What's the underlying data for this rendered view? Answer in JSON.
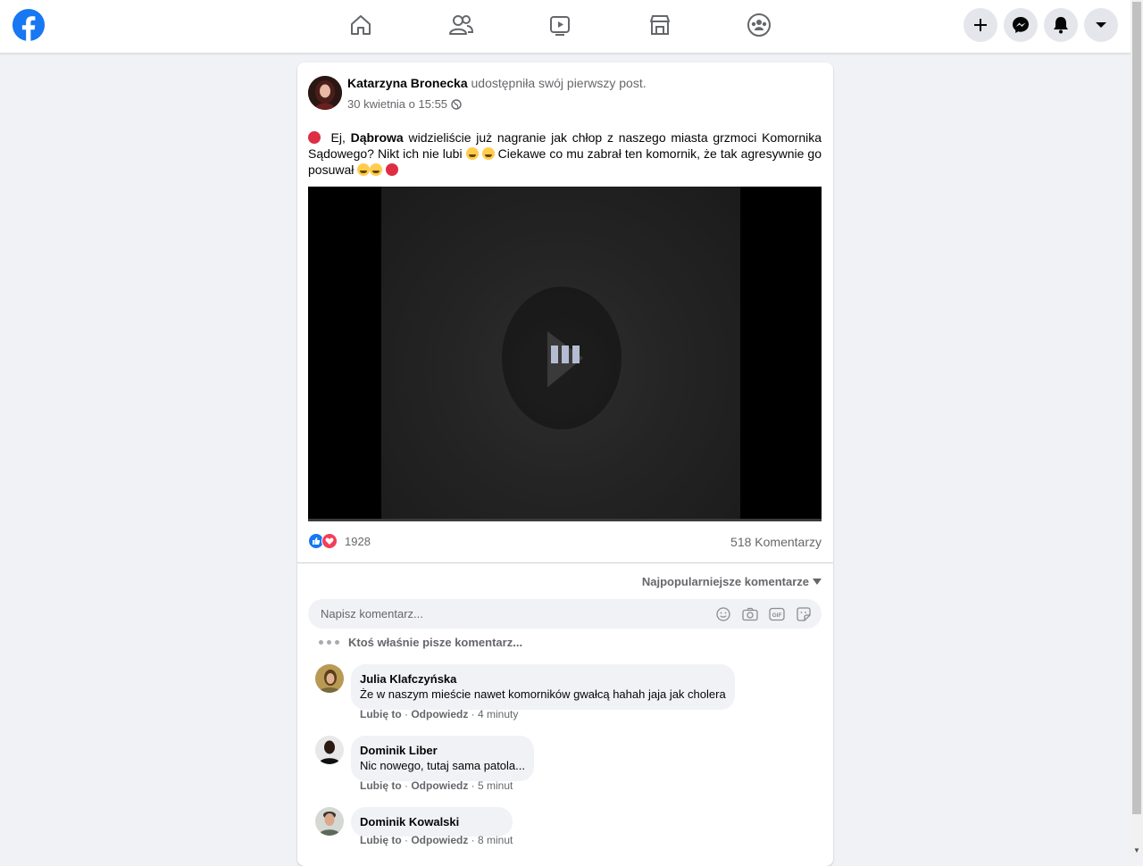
{
  "colors": {
    "brand": "#1877f2",
    "background": "#f0f2f5",
    "like": "#1877f2",
    "love": "#f33e58"
  },
  "topbar": {
    "nav": [
      "home-icon",
      "friends-icon",
      "watch-icon",
      "marketplace-icon",
      "groups-icon"
    ],
    "right_buttons": [
      "plus-icon",
      "messenger-icon",
      "notifications-icon",
      "chevron-down-icon"
    ]
  },
  "post": {
    "author": "Katarzyna Bronecka",
    "action": "udostępniła swój pierwszy post.",
    "time": "30 kwietnia o 15:55",
    "text_1": "Ej,",
    "text_bold": "Dąbrowa",
    "text_2": "widzieliście już nagranie jak chłop z naszego miasta grzmoci Komornika Sądowego? Nikt ich nie lubi",
    "text_3": "Ciekawe co mu zabrał ten komornik, że tak agresywnie go posuwał",
    "reactions_count": "1928",
    "comments_count": "518 Komentarzy"
  },
  "comments_section": {
    "sort_label": "Najpopularniejsze komentarze",
    "input_placeholder": "Napisz komentarz...",
    "typing": "Ktoś właśnie pisze komentarz...",
    "like_label": "Lubię to",
    "reply_label": "Odpowiedz",
    "items": [
      {
        "name": "Julia Klafczyńska",
        "text": "Że w naszym mieście nawet komorników gwałcą hahah jaja jak cholera",
        "time": "4 minuty"
      },
      {
        "name": "Dominik Liber",
        "text": "Nic nowego, tutaj sama patola...",
        "time": "5 minut"
      },
      {
        "name": "Dominik Kowalski",
        "text": "",
        "time": "8 minut"
      }
    ]
  }
}
